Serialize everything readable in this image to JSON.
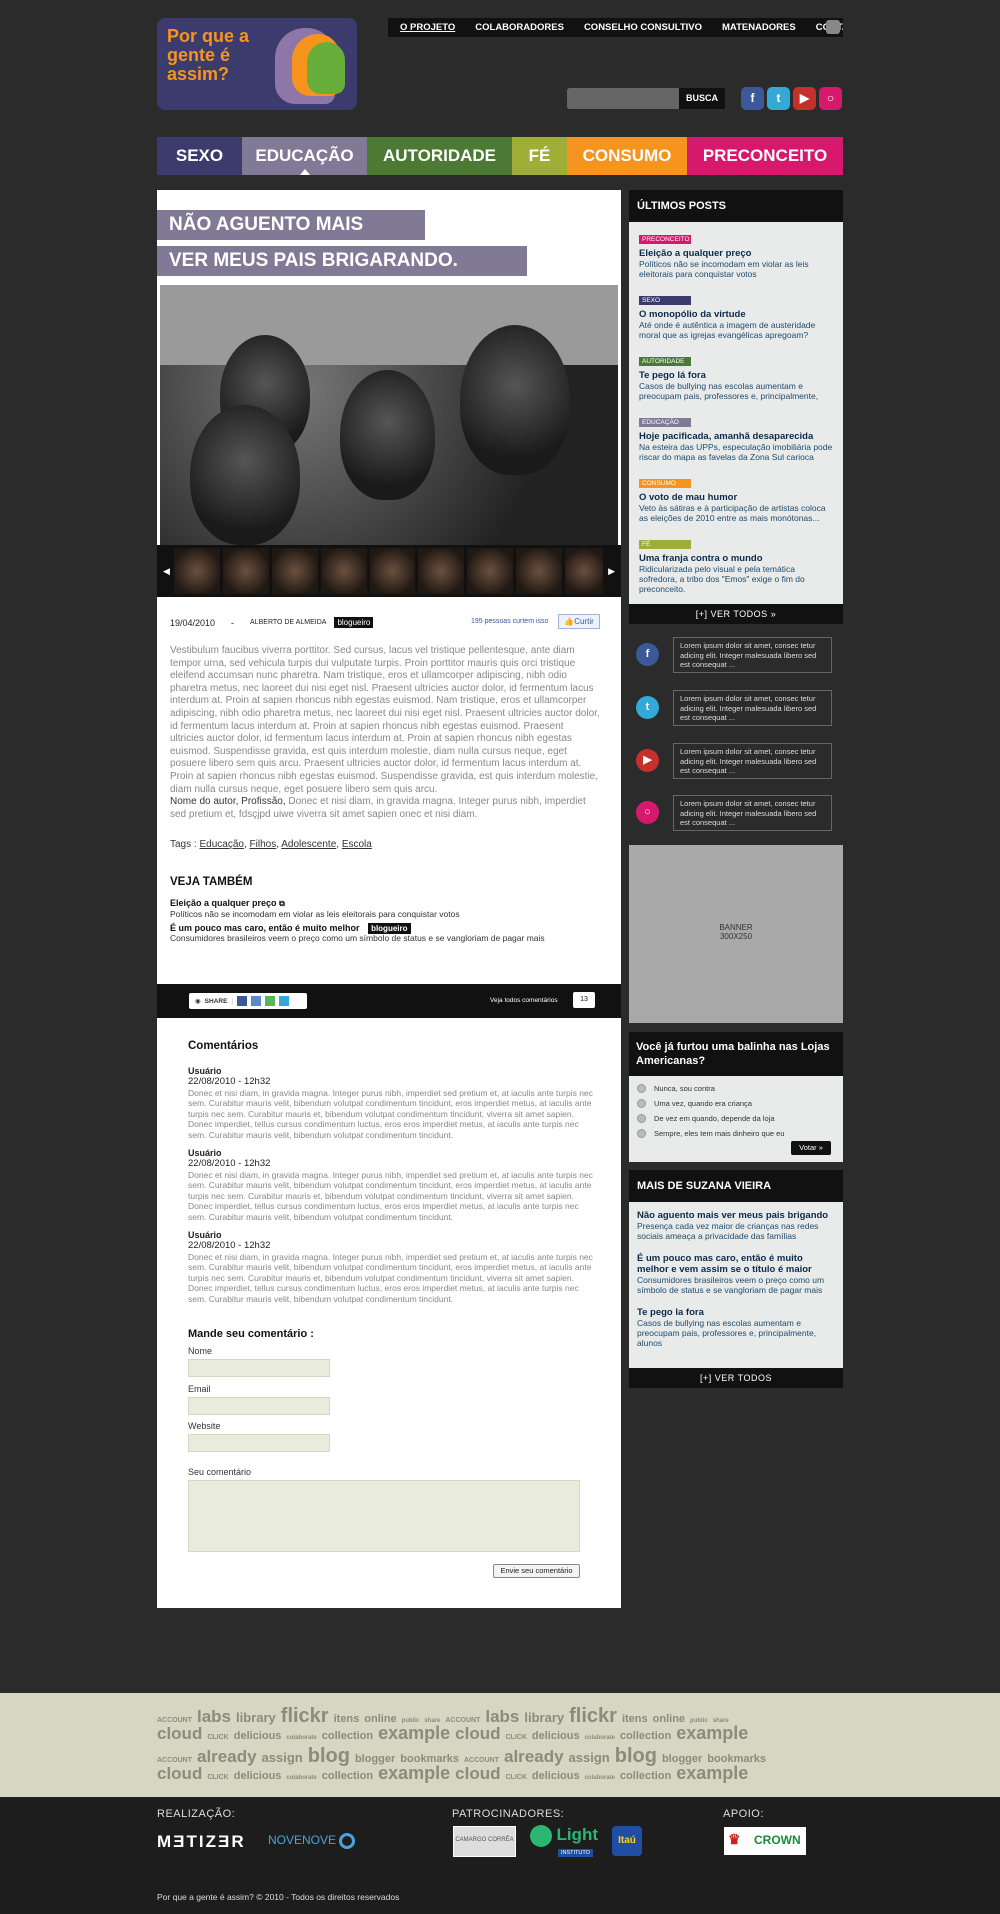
{
  "header": {
    "logo_text": "Por que a gente é assim?",
    "top_nav": [
      "O PROJETO",
      "COLABORADORES",
      "CONSELHO CONSULTIVO",
      "MATENADORES",
      "CONTATO"
    ],
    "search_button": "BUSCA"
  },
  "categories": [
    {
      "label": "SEXO",
      "color": "#3b3b6e"
    },
    {
      "label": "EDUCAÇÃO",
      "color": "#807a96"
    },
    {
      "label": "AUTORIDADE",
      "color": "#4c7a35"
    },
    {
      "label": "FÉ",
      "color": "#9fae37"
    },
    {
      "label": "CONSUMO",
      "color": "#f7941d"
    },
    {
      "label": "PRECONCEITO",
      "color": "#d7196d"
    }
  ],
  "article": {
    "headline_1": "NÃO AGUENTO MAIS",
    "headline_2": "VER MEUS PAIS BRIGARANDO.",
    "date": "19/04/2010",
    "sep": "-",
    "author": "ALBERTO DE ALMEIDA",
    "author_tag": "blogueiro",
    "likes_text": "195 pessoas curtem isso",
    "like_button": "Curtir",
    "body": "Vestibulum faucibus viverra porttitor. Sed cursus, lacus vel tristique pellentesque, ante diam tempor urna, sed vehicula turpis dui vulputate turpis. Proin porttitor mauris quis orci tristique eleifend accumsan nunc pharetra. Nam tristique, eros et ullamcorper adipiscing, nibh odio pharetra metus, nec laoreet dui nisi eget nisl. Praesent ultricies auctor dolor, id fermentum lacus interdum at. Proin at sapien rhoncus nibh egestas euismod. Nam tristique, eros et ullamcorper adipiscing, nibh odio pharetra metus, nec laoreet dui nisi eget nisl. Praesent ultricies auctor dolor, id fermentum lacus interdum at. Proin at sapien rhoncus nibh egestas euismod. Praesent ultricies auctor dolor, id fermentum lacus interdum at. Proin at sapien rhoncus nibh egestas euismod. Suspendisse gravida, est quis interdum molestie, diam nulla cursus neque, eget posuere libero sem quis arcu. Praesent ultricies auctor dolor, id fermentum lacus interdum at. Proin at sapien rhoncus nibh egestas euismod. Suspendisse gravida, est quis interdum molestie, diam nulla cursus neque, eget posuere libero sem quis arcu.",
    "author_bio_name": "Nome do autor, Profissão,",
    "author_bio_text": " Donec et nisi diam, in gravida magna. Integer purus nibh, imperdiet sed pretium et, fdsçjpd uiwe viverra sit amet sapien onec et nisi diam.",
    "tags_label": "Tags :",
    "tags": [
      "Educação",
      "Filhos",
      "Adolescente",
      "Escola"
    ],
    "see_also_title": "VEJA TAMBÉM",
    "see_also": [
      {
        "title": "Eleição a qualquer preço",
        "desc": "Políticos não se incomodam em violar as leis eleitorais para conquistar votos"
      },
      {
        "title": "É um pouco mas caro, então é muito melhor",
        "tag": "blogueiro",
        "desc": "Consumidores brasileiros veem o preço como um símbolo de status e se vangloriam de pagar mais"
      }
    ],
    "share_label": "SHARE",
    "view_comments": "Veja todos comentários",
    "comment_count": "13"
  },
  "comments": {
    "title": "Comentários",
    "items": [
      {
        "user": "Usuário",
        "date": "22/08/2010   -   12h32",
        "text": "Donec et nisi diam, in gravida magna. Integer purus nibh, imperdiet sed pretium et, at iaculis ante turpis nec sem. Curabitur mauris velit, bibendum volutpat condimentum tincidunt, eros imperdiet metus, at iaculis ante turpis nec sem. Curabitur mauris et, bibendum volutpat condimentum tincidunt, viverra sit amet sapien. Donec imperdiet, tellus cursus condimentum luctus, eros eros imperdiet metus, at iaculis ante turpis nec sem. Curabitur mauris velit, bibendum volutpat condimentum tincidunt."
      },
      {
        "user": "Usuário",
        "date": "22/08/2010   -   12h32",
        "text": "Donec et nisi diam, in gravida magna. Integer purus nibh, imperdiet sed pretium et, at iaculis ante turpis nec sem. Curabitur mauris velit, bibendum volutpat condimentum tincidunt, eros imperdiet metus, at iaculis ante turpis nec sem. Curabitur mauris et, bibendum volutpat condimentum tincidunt, viverra sit amet sapien. Donec imperdiet, tellus cursus condimentum luctus, eros eros imperdiet metus, at iaculis ante turpis nec sem. Curabitur mauris velit, bibendum volutpat condimentum tincidunt."
      },
      {
        "user": "Usuário",
        "date": "22/08/2010   -   12h32",
        "text": "Donec et nisi diam, in gravida magna. Integer purus nibh, imperdiet sed pretium et, at iaculis ante turpis nec sem. Curabitur mauris velit, bibendum volutpat condimentum tincidunt, eros imperdiet metus, at iaculis ante turpis nec sem. Curabitur mauris et, bibendum volutpat condimentum tincidunt, viverra sit amet sapien. Donec imperdiet, tellus cursus condimentum luctus, eros eros imperdiet metus, at iaculis ante turpis nec sem. Curabitur mauris velit, bibendum volutpat condimentum tincidunt."
      }
    ],
    "form_title": "Mande seu comentário :",
    "name_label": "Nome",
    "email_label": "Email",
    "website_label": "Website",
    "comment_label": "Seu comentário",
    "submit": "Envie seu comentário"
  },
  "sidebar": {
    "latest_title": "ÚLTIMOS POSTS",
    "latest": [
      {
        "tag": "PRECONCEITO",
        "color": "#d7196d",
        "title": "Eleição a qualquer preço",
        "desc": "Políticos não se incomodam em violar as leis eleitorais para conquistar votos"
      },
      {
        "tag": "SEXO",
        "color": "#3b3b6e",
        "title": "O monopólio da virtude",
        "desc": "Até onde é autêntica a imagem de austeridade moral que as igrejas evangélicas apregoam?"
      },
      {
        "tag": "AUTORIDADE",
        "color": "#4c7a35",
        "title": "Te pego lá fora",
        "desc": "Casos de bullying nas escolas aumentam e preocupam pais, professores e, principalmente,"
      },
      {
        "tag": "EDUCAÇÃO",
        "color": "#807a96",
        "title": "Hoje pacificada, amanhã desaparecida",
        "desc": "Na esteira das UPPs, especulação imobiliária pode riscar do mapa as favelas da Zona Sul carioca"
      },
      {
        "tag": "CONSUMO",
        "color": "#f7941d",
        "title": "O voto de mau humor",
        "desc": "Veto às sátiras e à participação de artistas coloca as eleições de 2010 entre as mais monótonas..."
      },
      {
        "tag": "FÉ",
        "color": "#9fae37",
        "title": "Uma franja contra o mundo",
        "desc": "Ridicularizada pelo visual e pela temática sofredora, a tribo dos \"Emos\" exige o fim do preconceito."
      }
    ],
    "see_all": "[+]  VER TODOS",
    "social_text": "Lorem ipsum dolor sit amet, consec tetur adicing elit. Integer malesuada libero sed est consequat ...",
    "banner_line1": "BANNER",
    "banner_line2": "300X250",
    "poll_question": "Você já furtou uma balinha nas Lojas Americanas?",
    "poll_options": [
      "Nunca, sou contra",
      "Uma vez, quando era criança",
      "De vez em quando, depende da loja",
      "Sempre, eles tem mais dinheiro que eu"
    ],
    "poll_vote": "Votar",
    "more_title": "MAIS DE SUZANA VIEIRA",
    "more": [
      {
        "title": "Não aguento mais ver meus pais brigando",
        "desc": "Presença cada vez maior de crianças nas redes sociais ameaça a privacidade das famílias"
      },
      {
        "title": "É um pouco mas caro, então é muito melhor e vem assim se o título é maior",
        "desc": "Consumidores brasileiros veem o preço como um símbolo de status e se vangloriam de pagar mais"
      },
      {
        "title": "Te pego la fora",
        "desc": "Casos de bullying nas escolas aumentam e preocupam pais, professores e, principalmente, alunos"
      }
    ],
    "more_see_all": "[+]  VER TODOS"
  },
  "cloud": {
    "rows": [
      [
        "ACCOUNT",
        "labs",
        "library",
        "flickr",
        "itens",
        "online",
        "public",
        "share",
        "ACCOUNT",
        "labs",
        "library",
        "flickr",
        "itens",
        "online",
        "public",
        "share"
      ],
      [
        "cloud",
        "CLICK",
        "delicious",
        "colaborate",
        "collection",
        "example",
        "cloud",
        "CLICK",
        "delicious",
        "colaborate",
        "collection",
        "example"
      ],
      [
        "ACCOUNT",
        "already",
        "assign",
        "blog",
        "blogger",
        "bookmarks",
        "ACCOUNT",
        "already",
        "assign",
        "blog",
        "blogger",
        "bookmarks"
      ],
      [
        "cloud",
        "CLICK",
        "delicious",
        "colaborate",
        "collection",
        "example",
        "cloud",
        "CLICK",
        "delicious",
        "colaborate",
        "collection",
        "example"
      ]
    ]
  },
  "footer": {
    "realizacao": "REALIZAÇÃO:",
    "patrocinadores": "PATROCINADORES:",
    "apoio": "APOIO:",
    "matizar": "MƎTIZƎR",
    "novenove": "NOVENOVE",
    "camargo": "CAMARGO CORRÊA",
    "light": "Light",
    "light_sub": "INSTITUTO",
    "itau": "Itaú",
    "crown": "CROWN",
    "copyright": "Por que a gente é assim? © 2010 - Todos os direitos reservados"
  }
}
